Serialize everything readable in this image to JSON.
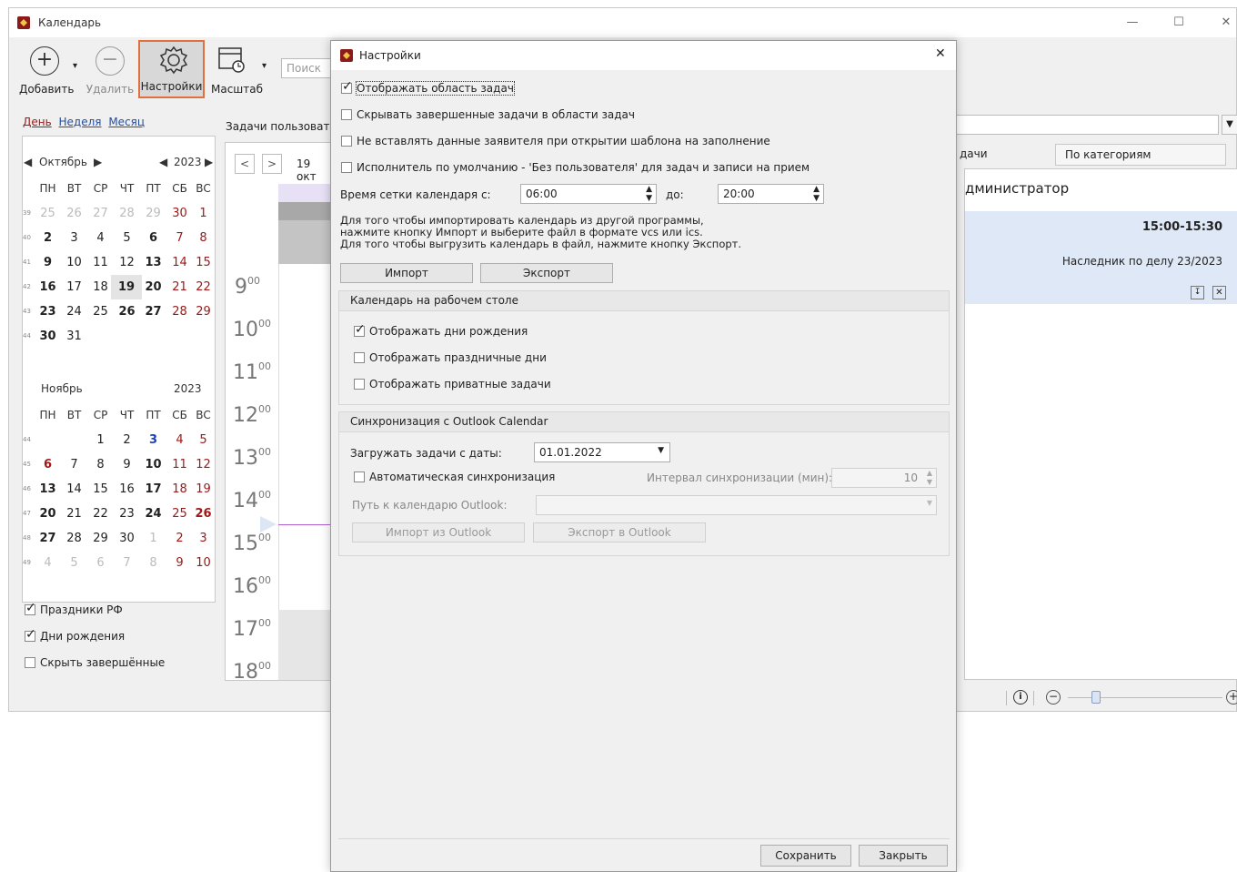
{
  "main": {
    "title": "Календарь",
    "toolbar": {
      "add": "Добавить",
      "delete": "Удалить",
      "settings": "Настройки",
      "scale": "Масштаб",
      "search_placeholder": "Поиск"
    },
    "views": {
      "day": "День",
      "week": "Неделя",
      "month": "Месяц"
    },
    "tasks_label": "Задачи пользовате",
    "october": {
      "month": "Октябрь",
      "year": "2023"
    },
    "november": {
      "month": "Ноябрь",
      "year": "2023"
    },
    "weekdays": [
      "ПН",
      "ВТ",
      "СР",
      "ЧТ",
      "ПТ",
      "СБ",
      "ВС"
    ],
    "checks": {
      "holidays": "Праздники РФ",
      "birthdays": "Дни рождения",
      "hide_done": "Скрыть завершённые"
    },
    "day_header": "19 окт",
    "hours": [
      "9",
      "10",
      "11",
      "12",
      "13",
      "14",
      "15",
      "16",
      "17",
      "18"
    ],
    "hour_suffix": "00",
    "right": {
      "tab_left": "дачи",
      "tab_right": "По категориям",
      "user": "дминистратор",
      "time": "15:00-15:30",
      "task": "Наследник по делу 23/2023"
    }
  },
  "dialog": {
    "title": "Настройки",
    "opt_show_tasks": "Отображать область задач",
    "opt_hide_done": "Скрывать завершенные задачи в области задач",
    "opt_no_applicant": "Не вставлять данные заявителя при открытии шаблона на заполнение",
    "opt_default_exec": "Исполнитель по умолчанию - 'Без пользователя' для задач и записи на прием",
    "grid_from_label": "Время сетки календаря с:",
    "grid_from": "06:00",
    "grid_to_label": "до:",
    "grid_to": "20:00",
    "info_line1": "Для того чтобы импортировать календарь из другой программы,",
    "info_line2": "нажмите кнопку Импорт и выберите файл в формате vcs или ics.",
    "info_line3": "Для того чтобы выгрузить календарь в файл, нажмите кнопку Экспорт.",
    "import": "Импорт",
    "export": "Экспорт",
    "desktop_group": "Календарь на рабочем столе",
    "show_birthdays": "Отображать дни рождения",
    "show_holidays": "Отображать праздничные дни",
    "show_private": "Отображать приватные задачи",
    "outlook_group": "Синхронизация с Outlook Calendar",
    "load_from_label": "Загружать задачи с даты:",
    "load_from": "01.01.2022",
    "auto_sync": "Автоматическая синхронизация",
    "interval_label": "Интервал синхронизации (мин):",
    "interval": "10",
    "path_label": "Путь к календарю Outlook:",
    "import_outlook": "Импорт из Outlook",
    "export_outlook": "Экспорт в Outlook",
    "save": "Сохранить",
    "close": "Закрыть"
  }
}
